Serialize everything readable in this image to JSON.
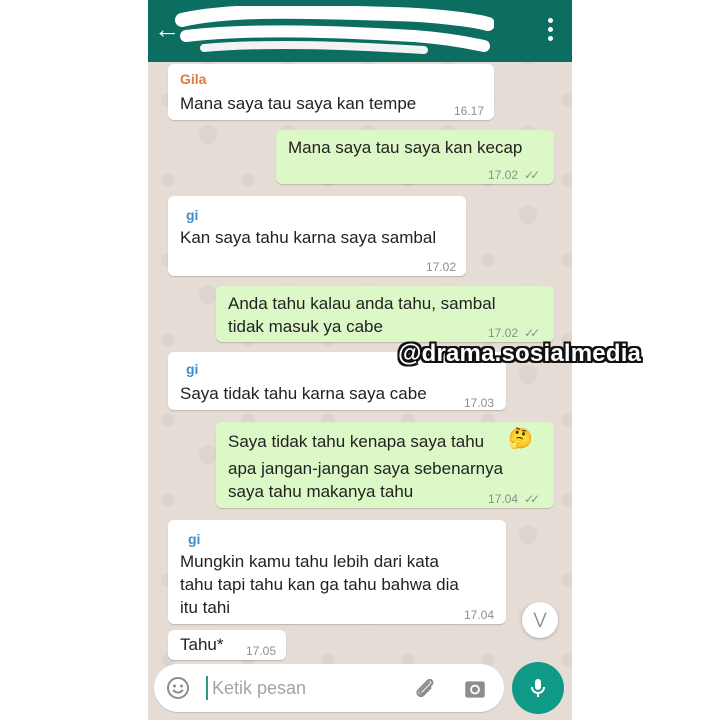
{
  "header": {
    "back_icon": "arrow-left-icon",
    "menu_icon": "more-vert-icon"
  },
  "watermark": "@drama.sosialmedia",
  "messages": [
    {
      "direction": "in",
      "sender": "Gila",
      "text": "Mana saya tau saya kan tempe",
      "time": "16.17"
    },
    {
      "direction": "out",
      "text": "Mana saya tau saya kan kecap",
      "time": "17.02",
      "status": "read"
    },
    {
      "direction": "in",
      "sender": "gi",
      "text": "Kan saya tahu karna saya sambal",
      "time": "17.02"
    },
    {
      "direction": "out",
      "lines": [
        "Anda tahu kalau anda tahu, sambal",
        "tidak masuk ya cabe"
      ],
      "time": "17.02",
      "status": "read"
    },
    {
      "direction": "in",
      "sender": "gi",
      "text": "Saya tidak tahu karna saya cabe",
      "time": "17.03"
    },
    {
      "direction": "out",
      "lines": [
        "Saya tidak tahu kenapa saya tahu",
        "apa jangan-jangan saya sebenarnya",
        "saya tahu makanya tahu"
      ],
      "emoji": "🤔",
      "time": "17.04",
      "status": "read"
    },
    {
      "direction": "in",
      "sender": "gi",
      "lines": [
        "Mungkin kamu tahu lebih dari kata",
        "tahu tapi tahu kan ga tahu bahwa dia",
        "itu tahi"
      ],
      "time": "17.04"
    },
    {
      "direction": "in",
      "text": "Tahu*",
      "time": "17.05"
    }
  ],
  "input": {
    "placeholder": "Ketik pesan",
    "emoji_icon": "emoji-icon",
    "attach_icon": "paperclip-icon",
    "camera_icon": "camera-icon",
    "mic_icon": "mic-icon",
    "scroll_icon": "double-chevron-down-icon"
  },
  "colors": {
    "header": "#0b6e60",
    "outgoing_bubble": "#dcf8c6",
    "incoming_bubble": "#ffffff",
    "mic_button": "#0e9a86"
  }
}
